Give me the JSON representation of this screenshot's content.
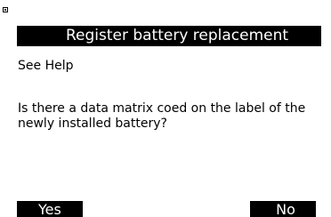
{
  "header": {
    "title": "Register battery replacement"
  },
  "content": {
    "help_link": "See Help",
    "question": "Is there a data matrix coed on the label of the newly installed battery?"
  },
  "softkeys": {
    "yes_label": "Yes",
    "no_label": "No"
  },
  "colors": {
    "background": "#ffffff",
    "bar": "#000000",
    "bar_text": "#ffffff",
    "text": "#000000"
  }
}
